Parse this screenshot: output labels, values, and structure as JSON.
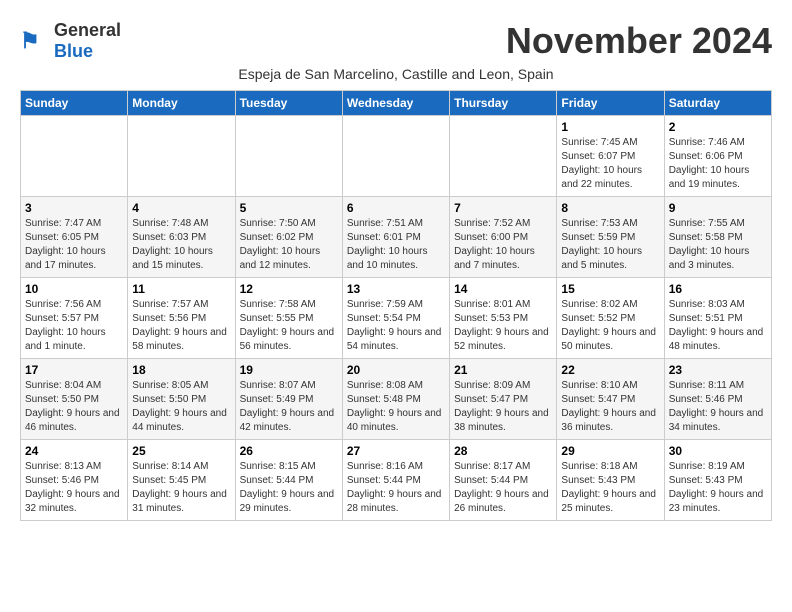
{
  "header": {
    "logo_general": "General",
    "logo_blue": "Blue",
    "month_title": "November 2024",
    "subtitle": "Espeja de San Marcelino, Castille and Leon, Spain"
  },
  "weekdays": [
    "Sunday",
    "Monday",
    "Tuesday",
    "Wednesday",
    "Thursday",
    "Friday",
    "Saturday"
  ],
  "weeks": [
    [
      {
        "day": "",
        "info": ""
      },
      {
        "day": "",
        "info": ""
      },
      {
        "day": "",
        "info": ""
      },
      {
        "day": "",
        "info": ""
      },
      {
        "day": "",
        "info": ""
      },
      {
        "day": "1",
        "info": "Sunrise: 7:45 AM\nSunset: 6:07 PM\nDaylight: 10 hours and 22 minutes."
      },
      {
        "day": "2",
        "info": "Sunrise: 7:46 AM\nSunset: 6:06 PM\nDaylight: 10 hours and 19 minutes."
      }
    ],
    [
      {
        "day": "3",
        "info": "Sunrise: 7:47 AM\nSunset: 6:05 PM\nDaylight: 10 hours and 17 minutes."
      },
      {
        "day": "4",
        "info": "Sunrise: 7:48 AM\nSunset: 6:03 PM\nDaylight: 10 hours and 15 minutes."
      },
      {
        "day": "5",
        "info": "Sunrise: 7:50 AM\nSunset: 6:02 PM\nDaylight: 10 hours and 12 minutes."
      },
      {
        "day": "6",
        "info": "Sunrise: 7:51 AM\nSunset: 6:01 PM\nDaylight: 10 hours and 10 minutes."
      },
      {
        "day": "7",
        "info": "Sunrise: 7:52 AM\nSunset: 6:00 PM\nDaylight: 10 hours and 7 minutes."
      },
      {
        "day": "8",
        "info": "Sunrise: 7:53 AM\nSunset: 5:59 PM\nDaylight: 10 hours and 5 minutes."
      },
      {
        "day": "9",
        "info": "Sunrise: 7:55 AM\nSunset: 5:58 PM\nDaylight: 10 hours and 3 minutes."
      }
    ],
    [
      {
        "day": "10",
        "info": "Sunrise: 7:56 AM\nSunset: 5:57 PM\nDaylight: 10 hours and 1 minute."
      },
      {
        "day": "11",
        "info": "Sunrise: 7:57 AM\nSunset: 5:56 PM\nDaylight: 9 hours and 58 minutes."
      },
      {
        "day": "12",
        "info": "Sunrise: 7:58 AM\nSunset: 5:55 PM\nDaylight: 9 hours and 56 minutes."
      },
      {
        "day": "13",
        "info": "Sunrise: 7:59 AM\nSunset: 5:54 PM\nDaylight: 9 hours and 54 minutes."
      },
      {
        "day": "14",
        "info": "Sunrise: 8:01 AM\nSunset: 5:53 PM\nDaylight: 9 hours and 52 minutes."
      },
      {
        "day": "15",
        "info": "Sunrise: 8:02 AM\nSunset: 5:52 PM\nDaylight: 9 hours and 50 minutes."
      },
      {
        "day": "16",
        "info": "Sunrise: 8:03 AM\nSunset: 5:51 PM\nDaylight: 9 hours and 48 minutes."
      }
    ],
    [
      {
        "day": "17",
        "info": "Sunrise: 8:04 AM\nSunset: 5:50 PM\nDaylight: 9 hours and 46 minutes."
      },
      {
        "day": "18",
        "info": "Sunrise: 8:05 AM\nSunset: 5:50 PM\nDaylight: 9 hours and 44 minutes."
      },
      {
        "day": "19",
        "info": "Sunrise: 8:07 AM\nSunset: 5:49 PM\nDaylight: 9 hours and 42 minutes."
      },
      {
        "day": "20",
        "info": "Sunrise: 8:08 AM\nSunset: 5:48 PM\nDaylight: 9 hours and 40 minutes."
      },
      {
        "day": "21",
        "info": "Sunrise: 8:09 AM\nSunset: 5:47 PM\nDaylight: 9 hours and 38 minutes."
      },
      {
        "day": "22",
        "info": "Sunrise: 8:10 AM\nSunset: 5:47 PM\nDaylight: 9 hours and 36 minutes."
      },
      {
        "day": "23",
        "info": "Sunrise: 8:11 AM\nSunset: 5:46 PM\nDaylight: 9 hours and 34 minutes."
      }
    ],
    [
      {
        "day": "24",
        "info": "Sunrise: 8:13 AM\nSunset: 5:46 PM\nDaylight: 9 hours and 32 minutes."
      },
      {
        "day": "25",
        "info": "Sunrise: 8:14 AM\nSunset: 5:45 PM\nDaylight: 9 hours and 31 minutes."
      },
      {
        "day": "26",
        "info": "Sunrise: 8:15 AM\nSunset: 5:44 PM\nDaylight: 9 hours and 29 minutes."
      },
      {
        "day": "27",
        "info": "Sunrise: 8:16 AM\nSunset: 5:44 PM\nDaylight: 9 hours and 28 minutes."
      },
      {
        "day": "28",
        "info": "Sunrise: 8:17 AM\nSunset: 5:44 PM\nDaylight: 9 hours and 26 minutes."
      },
      {
        "day": "29",
        "info": "Sunrise: 8:18 AM\nSunset: 5:43 PM\nDaylight: 9 hours and 25 minutes."
      },
      {
        "day": "30",
        "info": "Sunrise: 8:19 AM\nSunset: 5:43 PM\nDaylight: 9 hours and 23 minutes."
      }
    ]
  ]
}
